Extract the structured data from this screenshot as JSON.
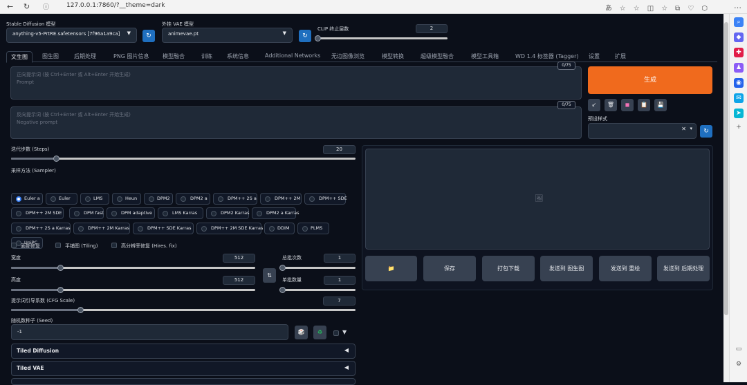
{
  "browser": {
    "url": "127.0.0.1:7860/?__theme=dark"
  },
  "top": {
    "model_label": "Stable Diffusion 模型",
    "model_value": "anything-v5-PrtRE.safetensors [7f96a1a9ca]",
    "vae_label": "外挂 VAE 模型",
    "vae_value": "animevae.pt",
    "clip_label": "CLIP 终止层数",
    "clip_value": "2",
    "clip_level": 0.0
  },
  "tabs": [
    "文生图",
    "图生图",
    "后期处理",
    "PNG 图片信息",
    "模型融合",
    "训练",
    "系统信息",
    "Additional Networks",
    "无边图像浏览",
    "模型转换",
    "超级模型融合",
    "模型工具箱",
    "WD 1.4 标签器 (Tagger)",
    "设置",
    "扩展"
  ],
  "prompt": {
    "placeholder_line1": "正向提示词 (按 Ctrl+Enter 或 Alt+Enter 开始生成)",
    "placeholder_line2": "Prompt",
    "count": "0/75"
  },
  "neg_prompt": {
    "placeholder_line1": "反向提示词 (按 Ctrl+Enter 或 Alt+Enter 开始生成)",
    "placeholder_line2": "Negative prompt",
    "count": "0/75"
  },
  "generate_label": "生成",
  "styles_label": "预设样式",
  "steps": {
    "label": "迭代步数 (Steps)",
    "value": "20",
    "level": 0.13
  },
  "sampler": {
    "label": "采样方法 (Sampler)",
    "selected": "Euler a",
    "options": [
      "Euler a",
      "Euler",
      "LMS",
      "Heun",
      "DPM2",
      "DPM2 a",
      "DPM++ 2S a",
      "DPM++ 2M",
      "DPM++ SDE",
      "DPM++ 2M SDE",
      "DPM fast",
      "DPM adaptive",
      "LMS Karras",
      "DPM2 Karras",
      "DPM2 a Karras",
      "DPM++ 2S a Karras",
      "DPM++ 2M Karras",
      "DPM++ SDE Karras",
      "DPM++ 2M SDE Karras",
      "DDIM",
      "PLMS",
      "UniPC"
    ]
  },
  "checks": {
    "face": "面部修复",
    "tiling": "平铺图 (Tiling)",
    "hires": "高分辨率修复 (Hires. fix)"
  },
  "width": {
    "label": "宽度",
    "value": "512",
    "level": 0.2
  },
  "height": {
    "label": "高度",
    "value": "512",
    "level": 0.2
  },
  "batch_count": {
    "label": "总批次数",
    "value": "1",
    "level": 0.0
  },
  "batch_size": {
    "label": "单批数量",
    "value": "1",
    "level": 0.0
  },
  "cfg": {
    "label": "提示词引导系数 (CFG Scale)",
    "value": "7",
    "level": 0.2
  },
  "seed": {
    "label": "随机数种子 (Seed)",
    "value": "-1"
  },
  "accordions": [
    "Tiled Diffusion",
    "Tiled VAE"
  ],
  "actions": [
    "保存",
    "打包下载",
    "发送到 图生图",
    "发送到 重绘",
    "发送到 后期处理"
  ]
}
